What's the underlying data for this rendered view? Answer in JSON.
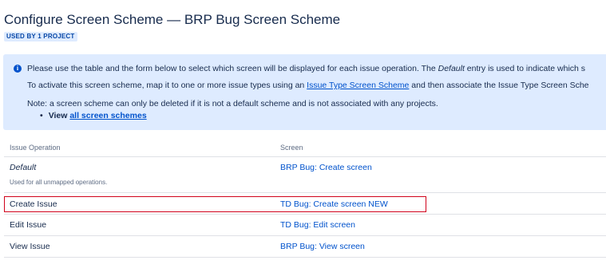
{
  "header": {
    "title": "Configure Screen Scheme — BRP Bug Screen Scheme",
    "badge": "USED BY 1 PROJECT"
  },
  "info": {
    "icon": "info-icon",
    "line1_a": "Please use the table and the form below to select which screen will be displayed for each issue operation. The ",
    "line1_em": "Default",
    "line1_b": " entry is used to indicate which s",
    "line2_a": "To activate this screen scheme, map it to one or more issue types using an ",
    "line2_link": "Issue Type Screen Scheme",
    "line2_b": " and then associate the Issue Type Screen Sche",
    "line3": "Note: a screen scheme can only be deleted if it is not a default scheme and is not associated with any projects.",
    "list_prefix": "View ",
    "list_link": "all screen schemes"
  },
  "table": {
    "headers": [
      "Issue Operation",
      "Screen"
    ],
    "rows": [
      {
        "operation": "Default",
        "note": "Used for all unmapped operations.",
        "screen": "BRP Bug: Create screen"
      },
      {
        "operation": "Create Issue",
        "screen": "TD Bug: Create screen NEW"
      },
      {
        "operation": "Edit Issue",
        "screen": "TD Bug: Edit screen"
      },
      {
        "operation": "View Issue",
        "screen": "BRP Bug: View screen"
      }
    ]
  },
  "colors": {
    "link": "#0052cc",
    "info_bg": "#deebff",
    "highlight_border": "#d0021b"
  }
}
